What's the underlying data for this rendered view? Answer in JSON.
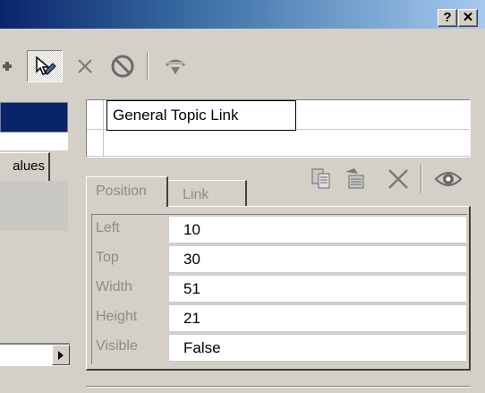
{
  "titlebar": {
    "help_label": "?",
    "close_label": "✕"
  },
  "left": {
    "values_tab": "alues"
  },
  "list": {
    "items": [
      "General Topic Link"
    ]
  },
  "tabs": [
    {
      "label": "Position"
    },
    {
      "label": "Link"
    }
  ],
  "properties": [
    {
      "name": "Left",
      "value": "10"
    },
    {
      "name": "Top",
      "value": "30"
    },
    {
      "name": "Width",
      "value": "51"
    },
    {
      "name": "Height",
      "value": "21"
    },
    {
      "name": "Visible",
      "value": "False"
    }
  ]
}
